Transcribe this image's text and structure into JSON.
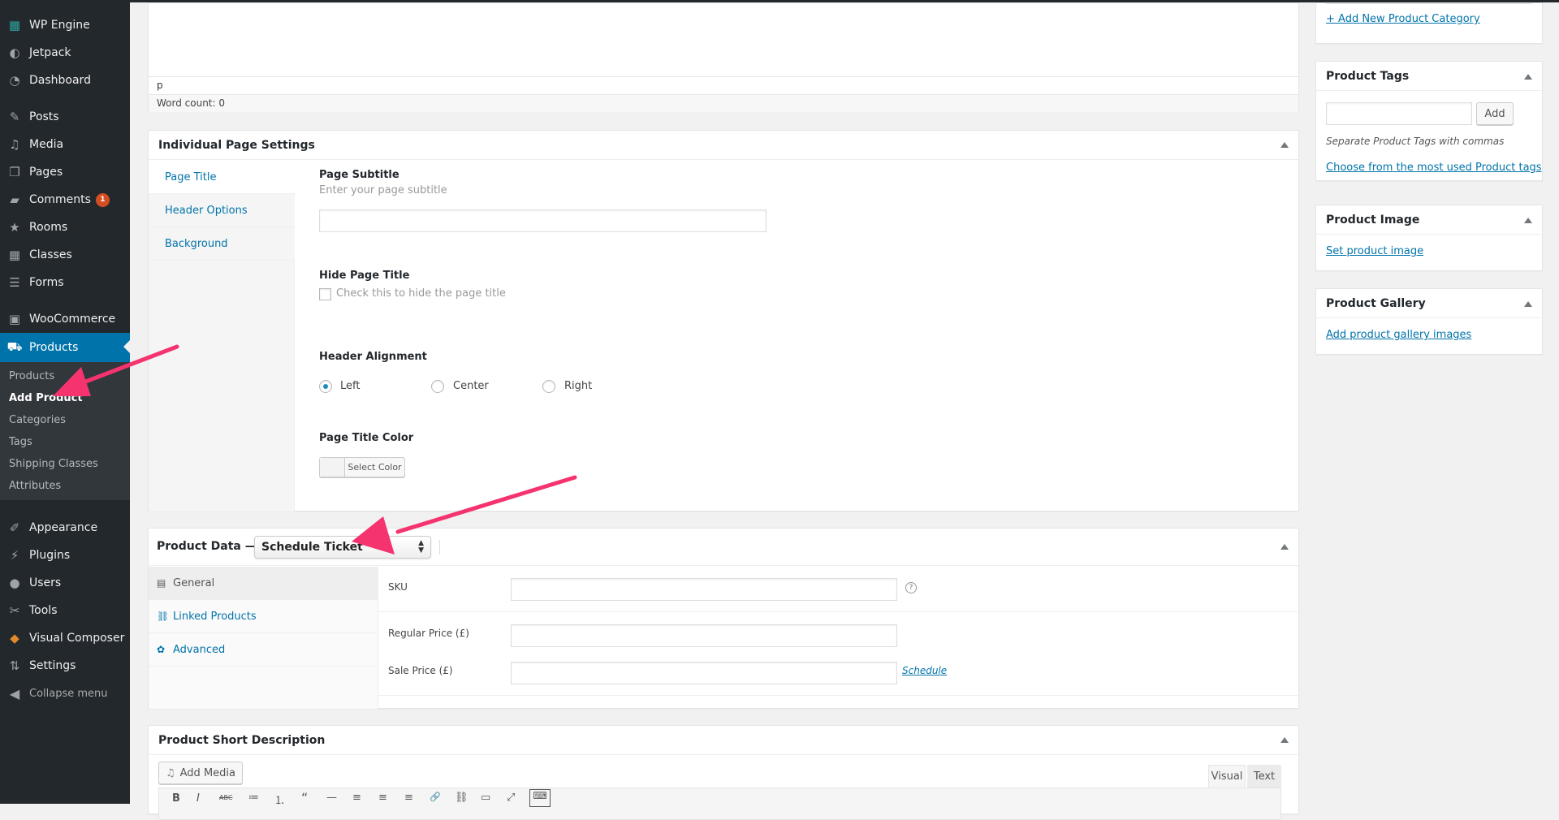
{
  "sidebar": {
    "items": [
      {
        "label": "WP Engine",
        "icon": "wp-engine-icon",
        "glyph": "▦"
      },
      {
        "label": "Jetpack",
        "icon": "jetpack-icon",
        "glyph": "◐"
      },
      {
        "label": "Dashboard",
        "icon": "dashboard-icon",
        "glyph": "◔"
      },
      {
        "label": "Posts",
        "icon": "pin-icon",
        "glyph": "✎"
      },
      {
        "label": "Media",
        "icon": "media-icon",
        "glyph": "♫"
      },
      {
        "label": "Pages",
        "icon": "pages-icon",
        "glyph": "❐"
      },
      {
        "label": "Comments",
        "icon": "comments-icon",
        "glyph": "▰",
        "badge": "1"
      },
      {
        "label": "Rooms",
        "icon": "star-icon",
        "glyph": "★"
      },
      {
        "label": "Classes",
        "icon": "calendar-icon",
        "glyph": "▦"
      },
      {
        "label": "Forms",
        "icon": "forms-icon",
        "glyph": "☰"
      },
      {
        "label": "WooCommerce",
        "icon": "woocommerce-icon",
        "glyph": "▣"
      },
      {
        "label": "Products",
        "icon": "cart-icon",
        "glyph": "⛟"
      },
      {
        "label": "Appearance",
        "icon": "brush-icon",
        "glyph": "✐"
      },
      {
        "label": "Plugins",
        "icon": "plugin-icon",
        "glyph": "⚡"
      },
      {
        "label": "Users",
        "icon": "user-icon",
        "glyph": "●"
      },
      {
        "label": "Tools",
        "icon": "wrench-icon",
        "glyph": "✂"
      },
      {
        "label": "Visual Composer",
        "icon": "visual-composer-icon",
        "glyph": "◆"
      },
      {
        "label": "Settings",
        "icon": "settings-icon",
        "glyph": "⇅"
      }
    ],
    "submenu": [
      "Products",
      "Add Product",
      "Categories",
      "Tags",
      "Shipping Classes",
      "Attributes"
    ],
    "collapse_label": "Collapse menu"
  },
  "editor": {
    "path": "p",
    "word_count": "Word count: 0"
  },
  "page_settings": {
    "title": "Individual Page Settings",
    "tabs": [
      "Page Title",
      "Header Options",
      "Background"
    ],
    "subtitle_label": "Page Subtitle",
    "subtitle_desc": "Enter your page subtitle",
    "subtitle_value": "",
    "hide_title_label": "Hide Page Title",
    "hide_title_desc": "Check this to hide the page title",
    "alignment_label": "Header Alignment",
    "alignment_options": [
      "Left",
      "Center",
      "Right"
    ],
    "alignment_selected": "Left",
    "color_label": "Page Title Color",
    "select_color": "Select Color"
  },
  "product_data": {
    "title": "Product Data —",
    "type_selected": "Schedule Ticket",
    "tabs": [
      "General",
      "Linked Products",
      "Advanced"
    ],
    "fields": {
      "sku_label": "SKU",
      "regular_price_label": "Regular Price (£)",
      "sale_price_label": "Sale Price (£)",
      "schedule_link": "Schedule"
    }
  },
  "short_description": {
    "title": "Product Short Description",
    "add_media": "Add Media",
    "tab_visual": "Visual",
    "tab_text": "Text",
    "toolbar": [
      "B",
      "I",
      "ABC",
      "≔",
      "⒈",
      "“",
      "—",
      "≡",
      "≡",
      "≡",
      "🔗",
      "⛓",
      "▭",
      "⤢",
      "⌨"
    ]
  },
  "right_sidebar": {
    "add_category_link": "+ Add New Product Category",
    "tags": {
      "title": "Product Tags",
      "add_button": "Add",
      "hint": "Separate Product Tags with commas",
      "most_used_link": "Choose from the most used Product tags"
    },
    "image": {
      "title": "Product Image",
      "link": "Set product image"
    },
    "gallery": {
      "title": "Product Gallery",
      "link": "Add product gallery images"
    }
  },
  "annotation_color": "#f5336e"
}
